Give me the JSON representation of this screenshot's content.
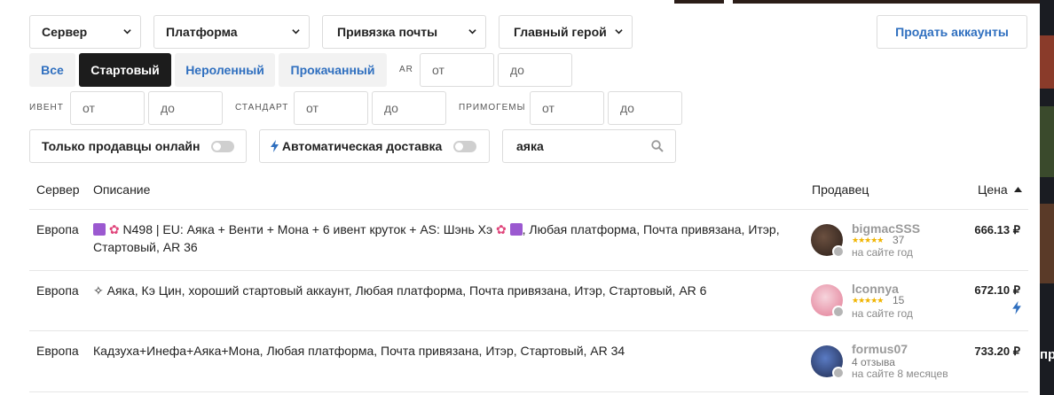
{
  "filters": {
    "server_label": "Сервер",
    "platform_label": "Платформа",
    "email_label": "Привязка почты",
    "hero_label": "Главный герой",
    "sell_button": "Продать аккаунты",
    "segments": [
      "Все",
      "Стартовый",
      "Нероленный",
      "Прокачанный"
    ],
    "active_segment": "Стартовый",
    "ar_label": "AR",
    "event_label": "ИВЕНТ",
    "standard_label": "СТАНДАРТ",
    "primogems_label": "ПРИМОГЕМЫ",
    "from_placeholder": "от",
    "to_placeholder": "до",
    "online_only_label": "Только продавцы онлайн",
    "auto_delivery_label": "Автоматическая доставка",
    "search_value": "аяка"
  },
  "table": {
    "headers": {
      "server": "Сервер",
      "description": "Описание",
      "seller": "Продавец",
      "price": "Цена"
    },
    "rows": [
      {
        "server": "Европа",
        "desc_main": "N498 | EU: Аяка + Венти + Мона + 6 ивент круток + AS: Шэнь Хэ",
        "desc_tail": ", Любая платформа, Почта привязана, Итэр,",
        "desc_line2": "Стартовый, AR 36",
        "seller": "bigmacSSS",
        "reviews": "37",
        "online": "на сайте год",
        "price": "666.13 ₽"
      },
      {
        "server": "Европа",
        "desc_main": "✧ Аяка, Кэ Цин, хороший стартовый аккаунт, Любая платформа, Почта привязана, Итэр, Стартовый, AR 6",
        "seller": "lconnya",
        "reviews": "15",
        "online": "на сайте год",
        "price": "672.10 ₽"
      },
      {
        "server": "Европа",
        "desc_main": "Кадзуха+Инефа+Аяка+Мона, Любая платформа, Почта привязана, Итэр, Стартовый, AR 34",
        "seller": "formus07",
        "reviews_text": "4 отзыва",
        "online": "на сайте 8 месяцев",
        "price": "733.20 ₽"
      }
    ]
  },
  "edge_text": "пр",
  "colors": {
    "accent": "#2f6fbf",
    "active": "#1c1c1c",
    "star": "#f0b400"
  }
}
